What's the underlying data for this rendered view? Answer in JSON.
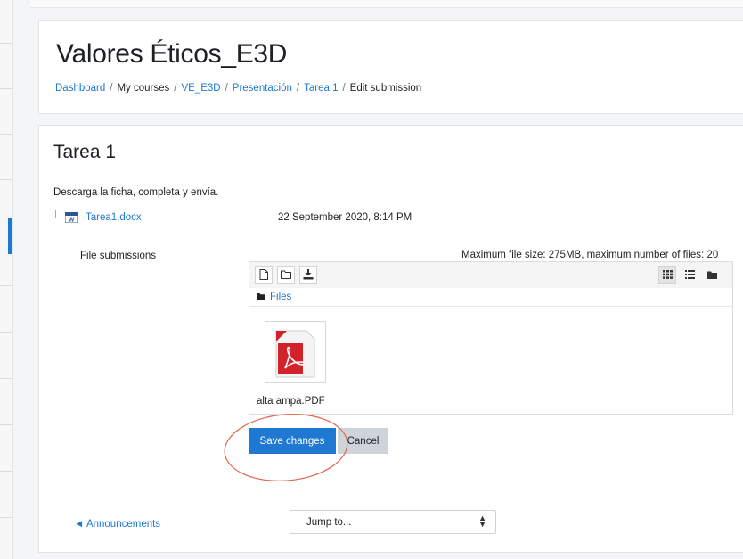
{
  "header": {
    "course_title": "Valores Éticos_E3D",
    "breadcrumb": [
      "Dashboard",
      "My courses",
      "VE_E3D",
      "Presentación",
      "Tarea 1",
      "Edit submission"
    ]
  },
  "assignment": {
    "title": "Tarea 1",
    "intro": "Descarga la ficha, completa y envía.",
    "attachment": {
      "name": "Tarea1.docx",
      "date": "22 September 2020, 8:14 PM"
    }
  },
  "file_submissions": {
    "label": "File submissions",
    "limits": "Maximum file size: 275MB, maximum number of files: 20",
    "path_label": "Files",
    "files": [
      {
        "name": "alta ampa.PDF",
        "icon": "pdf-icon"
      }
    ],
    "toolbar_icons": [
      "add-file-icon",
      "create-folder-icon",
      "download-icon",
      "grid-view-icon",
      "list-view-icon",
      "tree-view-icon"
    ]
  },
  "actions": {
    "save": "Save changes",
    "cancel": "Cancel"
  },
  "footer": {
    "prev_link": "◄ Announcements",
    "jump_placeholder": "Jump to..."
  },
  "colors": {
    "accent": "#1f78d1",
    "annotation": "#e0694f",
    "pdf_red": "#d2232a"
  }
}
